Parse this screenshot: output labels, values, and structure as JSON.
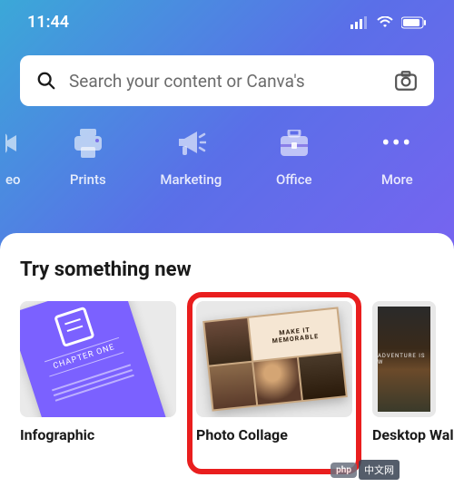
{
  "status": {
    "time": "11:44"
  },
  "search": {
    "placeholder": "Search your content or Canva's"
  },
  "categories": [
    {
      "id": "video",
      "label": "eo",
      "icon": "video-icon"
    },
    {
      "id": "prints",
      "label": "Prints",
      "icon": "printer-icon"
    },
    {
      "id": "marketing",
      "label": "Marketing",
      "icon": "megaphone-icon"
    },
    {
      "id": "office",
      "label": "Office",
      "icon": "briefcase-icon"
    },
    {
      "id": "more",
      "label": "More",
      "icon": "more-icon"
    }
  ],
  "section": {
    "title": "Try something new"
  },
  "cards": [
    {
      "title": "Infographic",
      "thumb_text": "CHAPTER ONE",
      "highlighted": false
    },
    {
      "title": "Photo Collage",
      "thumb_text_1": "MAKE IT",
      "thumb_text_2": "MEMORABLE",
      "highlighted": true
    },
    {
      "title": "Desktop Wal",
      "thumb_text": "ADVENTURE IS W",
      "highlighted": false
    }
  ],
  "watermark": {
    "badge": "php",
    "text": "中文网"
  }
}
